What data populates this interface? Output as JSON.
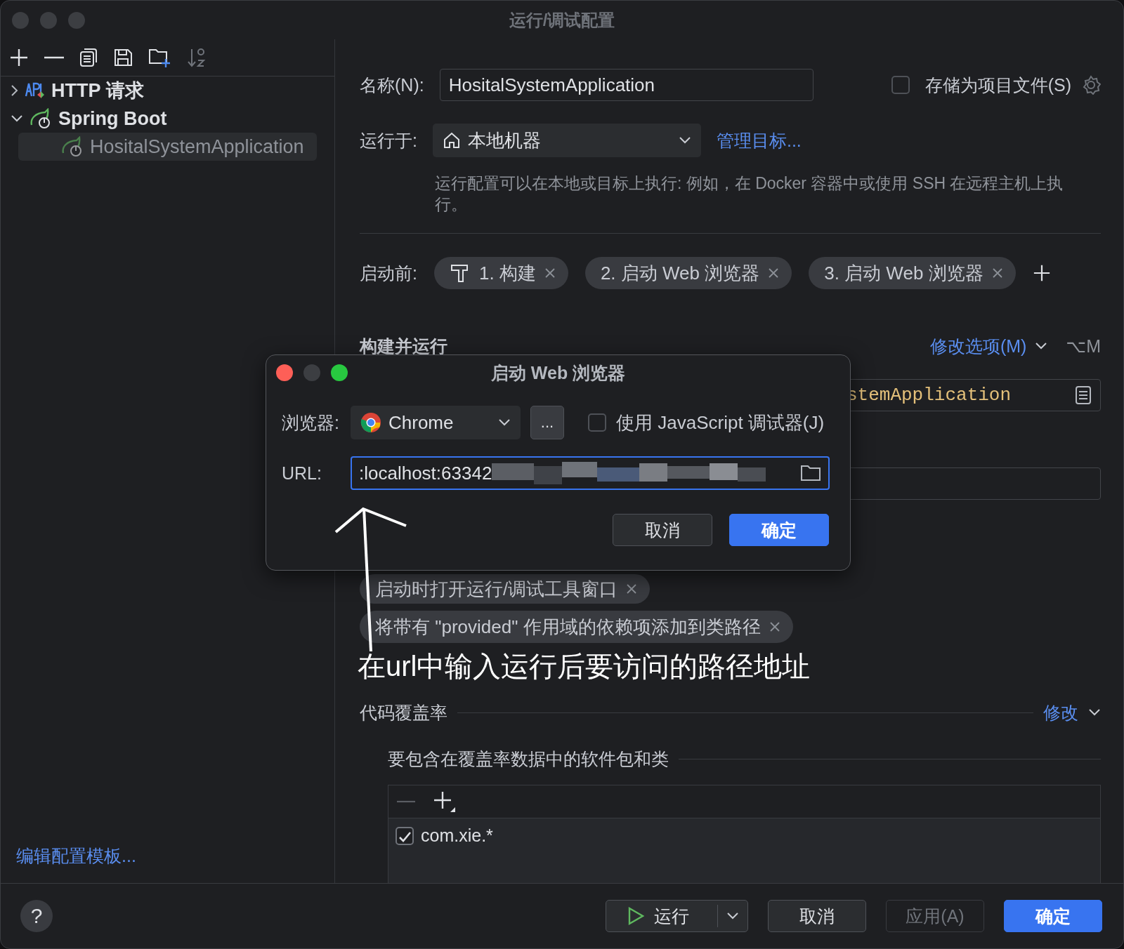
{
  "window": {
    "title": "运行/调试配置"
  },
  "tree": [
    {
      "label": "HTTP 请求",
      "kind": "http",
      "expanded": false,
      "selected": false
    },
    {
      "label": "Spring Boot",
      "kind": "spring",
      "expanded": true,
      "selected": false,
      "children": [
        {
          "label": "HositalSystemApplication",
          "kind": "spring",
          "selected": true
        }
      ]
    }
  ],
  "edit_templates_link": "编辑配置模板...",
  "form": {
    "name_label": "名称(N):",
    "name_value": "HositalSystemApplication",
    "store_option": {
      "label": "存储为项目文件(S)",
      "checked": false
    },
    "run_on": {
      "label": "运行于:",
      "value": "本地机器",
      "link": "管理目标..."
    },
    "description": "运行配置可以在本地或目标上执行: 例如，在 Docker 容器中或使用 SSH 在远程主机上执行。",
    "before_launch": {
      "label": "启动前:",
      "tasks": [
        {
          "label": "1. 构建",
          "kind": "build"
        },
        {
          "label": "2. 启动 Web 浏览器",
          "kind": "browser"
        },
        {
          "label": "3. 启动 Web 浏览器",
          "kind": "browser"
        }
      ]
    },
    "section_title": "构建并运行",
    "modify_options": {
      "label": "修改选项(M)",
      "shortcut": "⌥M"
    },
    "main_class_value": "stemApplication",
    "options": [
      {
        "label": "启动时打开运行/调试工具窗口"
      },
      {
        "label": "将带有 \"provided\" 作用域的依赖项添加到类路径"
      }
    ],
    "annotation": "在url中输入运行后要访问的路径地址",
    "coverage": {
      "title": "代码覆盖率",
      "link": "修改",
      "subtitle": "要包含在覆盖率数据中的软件包和类",
      "packages": [
        {
          "label": "com.xie.*",
          "checked": true
        }
      ]
    }
  },
  "help_button": "?",
  "buttons": [
    {
      "label": "运行",
      "kind": "run",
      "disabled": false
    },
    {
      "label": "取消",
      "kind": "normal",
      "disabled": false
    },
    {
      "label": "应用(A)",
      "kind": "normal",
      "disabled": true
    },
    {
      "label": "确定",
      "kind": "primary",
      "disabled": false
    }
  ],
  "dialog": {
    "title": "启动 Web 浏览器",
    "browser_label": "浏览器:",
    "browser_value": "Chrome",
    "more_button": "...",
    "js_debugger": {
      "label": "使用 JavaScript 调试器(J)",
      "checked": false
    },
    "url_label": "URL:",
    "url_value": ":localhost:63342",
    "buttons": [
      {
        "label": "取消",
        "kind": "normal"
      },
      {
        "label": "确定",
        "kind": "primary"
      }
    ]
  }
}
